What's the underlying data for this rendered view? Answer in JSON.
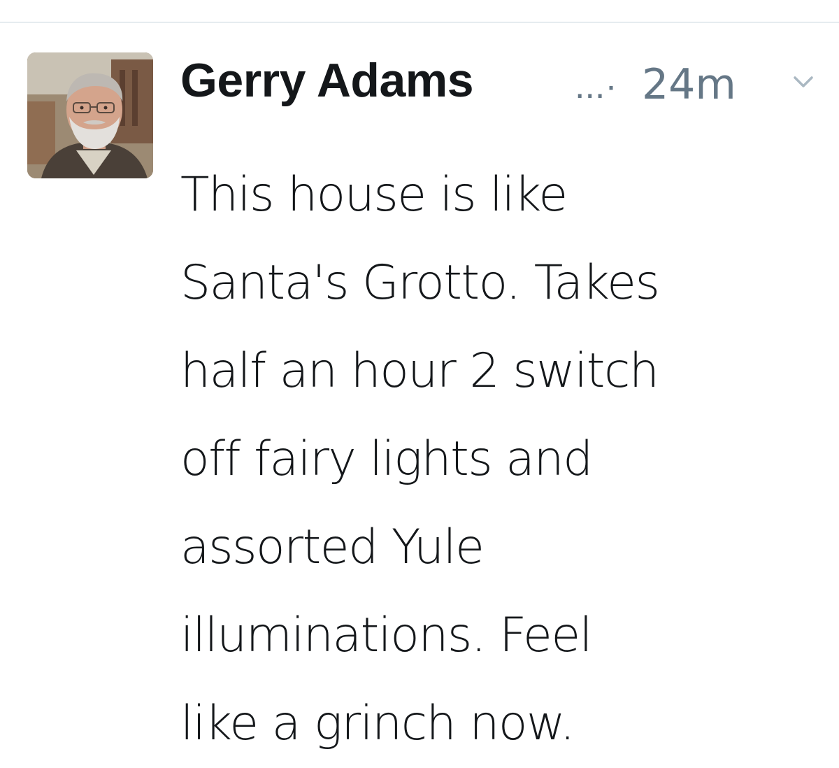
{
  "tweet": {
    "author": {
      "display_name": "Gerry Adams",
      "handle_truncated": "...",
      "avatar_icon": "user-avatar-photo"
    },
    "meta_separator": "·",
    "timestamp": "24m",
    "menu_icon": "chevron-down-icon",
    "text_lines": [
      "This house is like",
      "Santa's Grotto. Takes",
      "half an hour 2 switch",
      "off fairy lights and",
      "assorted Yule",
      "illuminations. Feel",
      "like a grinch now."
    ]
  },
  "colors": {
    "text_primary": "#14171a",
    "text_secondary": "#657786",
    "divider": "#e6ecf0",
    "background": "#ffffff"
  }
}
